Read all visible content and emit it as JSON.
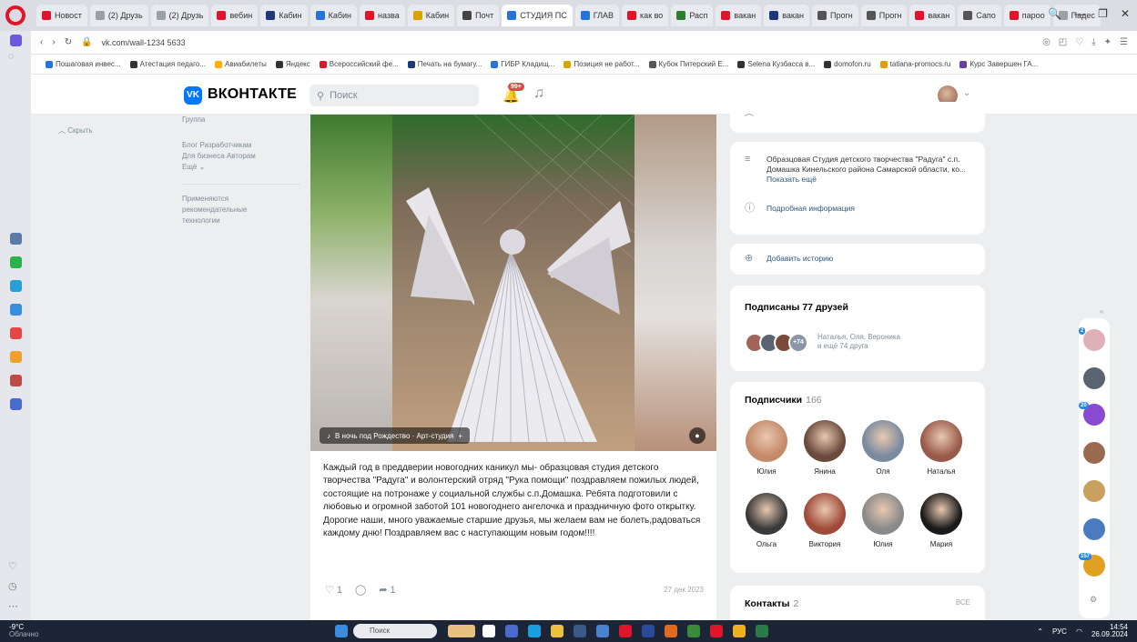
{
  "browser": {
    "tabs": [
      {
        "label": "Новост",
        "color": "#e0142a"
      },
      {
        "label": "(2) Друзь",
        "color": "#9aa0a6"
      },
      {
        "label": "(2) Друзь",
        "color": "#9aa0a6"
      },
      {
        "label": "вебин",
        "color": "#e0142a"
      },
      {
        "label": "Кабин",
        "color": "#1c3a7a"
      },
      {
        "label": "Кабин",
        "color": "#2673d9"
      },
      {
        "label": "назва",
        "color": "#e0142a"
      },
      {
        "label": "Кабин",
        "color": "#d9a400"
      },
      {
        "label": "Почт",
        "color": "#444"
      },
      {
        "label": "СТУДИЯ ПС",
        "color": "#2673d9",
        "active": true
      },
      {
        "label": "ГЛАВ",
        "color": "#2673d9"
      },
      {
        "label": "как во",
        "color": "#e0142a"
      },
      {
        "label": "Расп",
        "color": "#2d7d2d"
      },
      {
        "label": "вакан",
        "color": "#e0142a"
      },
      {
        "label": "вакан",
        "color": "#1c3a7a"
      },
      {
        "label": "Прогн",
        "color": "#555"
      },
      {
        "label": "Прогн",
        "color": "#555"
      },
      {
        "label": "вакан",
        "color": "#e0142a"
      },
      {
        "label": "Сапо",
        "color": "#555"
      },
      {
        "label": "пароо",
        "color": "#e0142a"
      },
      {
        "label": "Падес",
        "color": "#9aa0a6"
      }
    ],
    "window_controls": [
      "🔍",
      "—",
      "❐",
      "✕"
    ],
    "url": "vk.com/wall-1234 5633",
    "bookmarks": [
      {
        "label": "Пошаговая инвес...",
        "color": "#2673d9"
      },
      {
        "label": "Атестация педаго...",
        "color": "#333"
      },
      {
        "label": "Авиабилеты",
        "color": "#ffb300"
      },
      {
        "label": "Яндекс",
        "color": "#333"
      },
      {
        "label": "Всероссийский фе...",
        "color": "#e0142a"
      },
      {
        "label": "Печать на бумагу...",
        "color": "#1c3a7a"
      },
      {
        "label": "ГИБР Кладищ...",
        "color": "#2673d9"
      },
      {
        "label": "Позиция не работ...",
        "color": "#d9a400"
      },
      {
        "label": "Кубок Питерский Е...",
        "color": "#555"
      },
      {
        "label": "Selena Кузбасса в...",
        "color": "#333"
      },
      {
        "label": "domofon.ru",
        "color": "#333"
      },
      {
        "label": "tatiana-promocs.ru",
        "color": "#e0a000"
      },
      {
        "label": "Курс Завершен ГА...",
        "color": "#6b3fa0"
      }
    ]
  },
  "vk": {
    "brand": "ВКОНТАКТЕ",
    "search_placeholder": "Поиск",
    "notifications_badge": "99+",
    "left_menu": {
      "collapse_label": "Скрыть",
      "footer_lead": "Группа",
      "footer_links": "Блог   Разработчикам\nДля бизнеса   Авторам\nЕщё ⌄",
      "footer_note": "Применяются\nрекомендательные\nтехнологии"
    },
    "post": {
      "playlist_label": "В ночь под Рождество · Арт-студия",
      "text": "Каждый год в преддверии новогодних каникул мы- образцовая студия детского творчества \"Радуга\" и волонтерский отряд \"Рука помощи\" поздравляем пожилых людей, состоящие на потронаже у социальной службы с.п.Домашка. Ребята подготовили с любовью и огромной заботой 101 новогоднего ангелочка и праздничную фото открытку. Дорогие наши, много уважаемые старшие друзья, мы желаем вам не болеть,радоваться каждому дню! Поздравляем вас с наступающим новым годом!!!!",
      "likes": "1",
      "shares": "1",
      "date": "27 дек 2023"
    },
    "about": {
      "description_text": "Образцовая Студия детского творчества \"Радуга\" с.п. Домашка Кинельского района Самарской области, ко...",
      "description_more": "Показать ещё",
      "details_link": "Подробная информация",
      "add_story": "Добавить историю"
    },
    "friends": {
      "title": "Подписаны 77 друзей",
      "more_badge": "+74",
      "names_text": "Наталья, Оля, Вероника",
      "more_text": "и ещё 74 друга",
      "avatar_colors": [
        "#a0645a",
        "#5a6470",
        "#7a4a3a"
      ]
    },
    "subscribers": {
      "title": "Подписчики",
      "count": "166",
      "people": [
        {
          "name": "Юлия",
          "color": "#c58a6a"
        },
        {
          "name": "Янина",
          "color": "#6a4a3c"
        },
        {
          "name": "Оля",
          "color": "#7a8aa0"
        },
        {
          "name": "Наталья",
          "color": "#9a5a4a"
        },
        {
          "name": "Ольга",
          "color": "#3a3a3a"
        },
        {
          "name": "Виктория",
          "color": "#a04a3a"
        },
        {
          "name": "Юлия",
          "color": "#8a8a8a"
        },
        {
          "name": "Мария",
          "color": "#1a1a1a"
        }
      ]
    },
    "contacts": {
      "title": "Контакты",
      "count": "2",
      "right_text": "ВСЕ"
    },
    "minibar_counts": [
      "2",
      "20",
      "157"
    ]
  },
  "taskbar": {
    "weather_temp": "-9°C",
    "weather_desc": "Облачно",
    "search_placeholder": "Поиск",
    "lang": "РУС",
    "time": "14:54",
    "date": "26.09.2024"
  }
}
